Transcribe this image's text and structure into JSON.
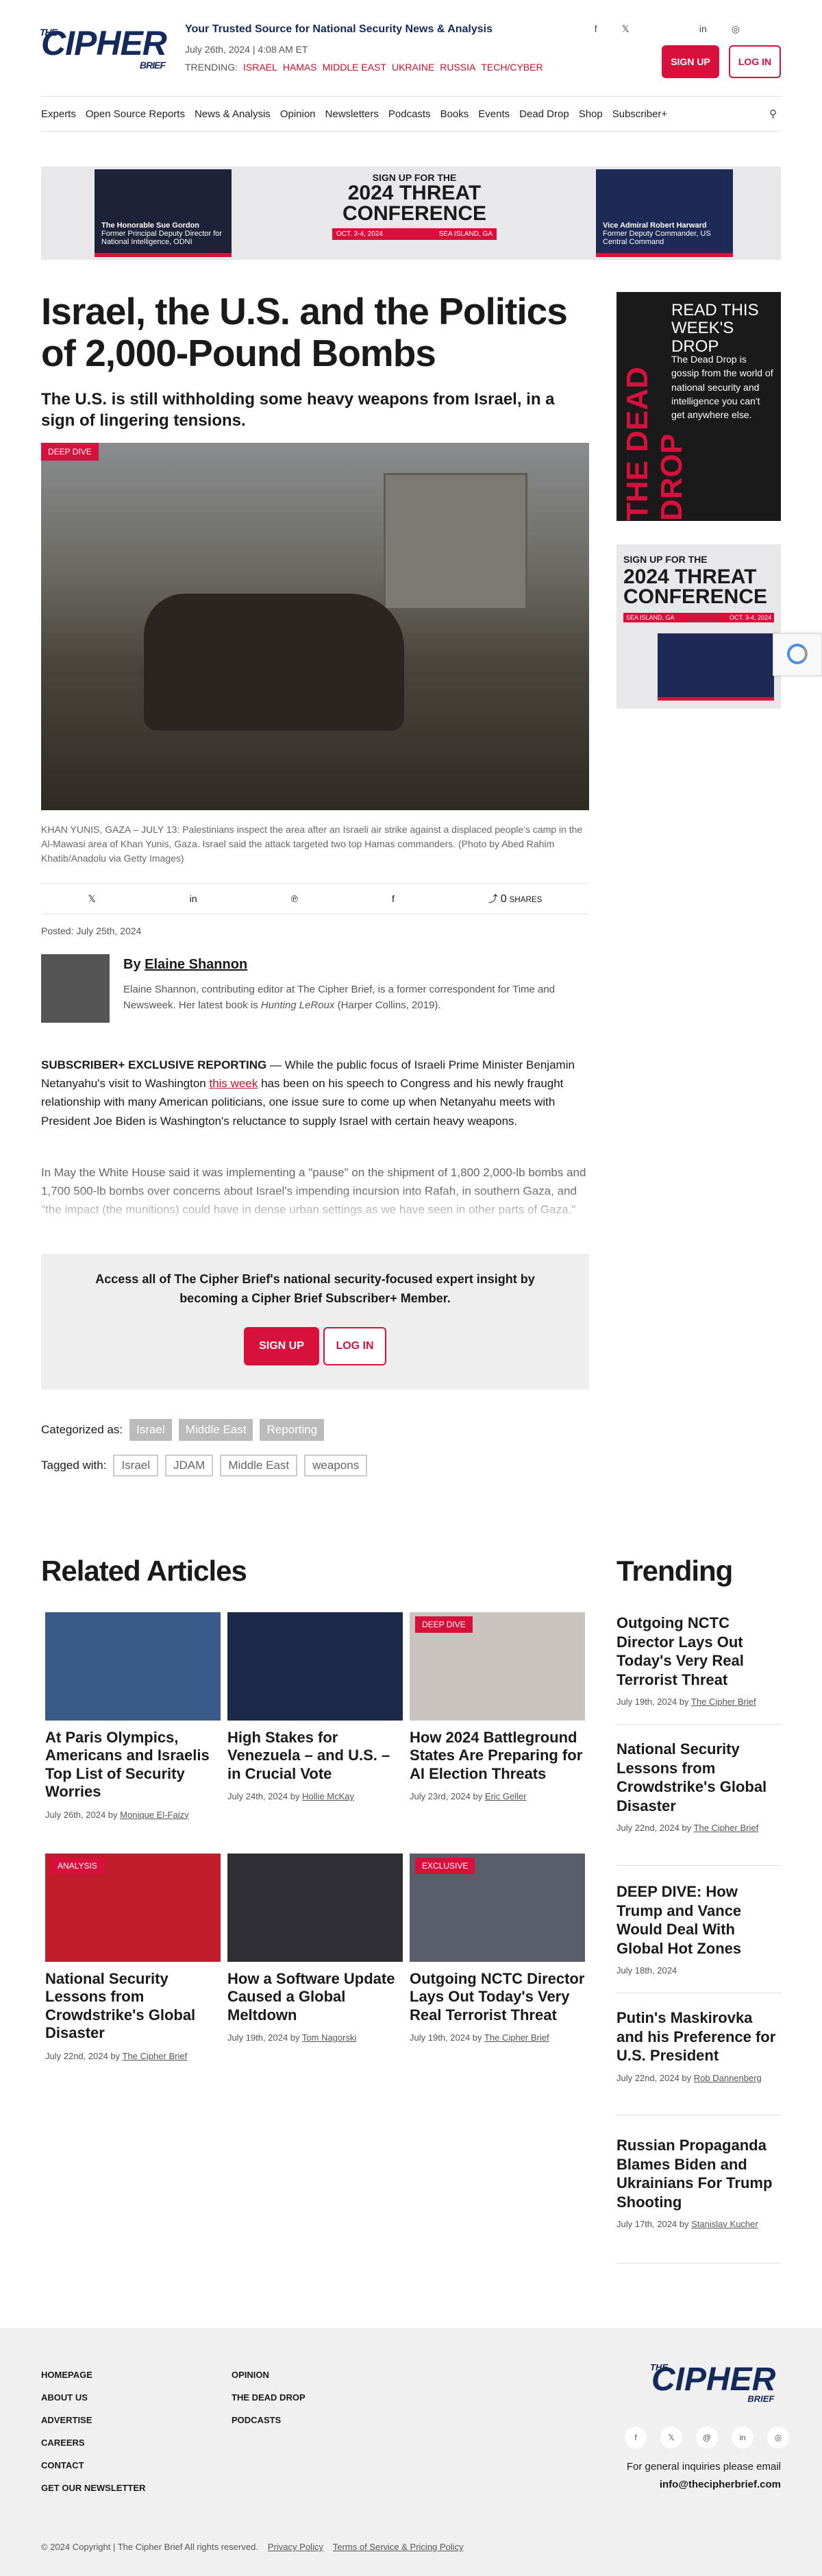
{
  "site": {
    "logo_the": "THE",
    "logo_main": "CIPHER",
    "logo_brief": "BRIEF",
    "tagline": "Your Trusted Source for National Security News & Analysis",
    "date": "July 26th, 2024 | 4:08 AM ET",
    "trending_label": "TRENDING:",
    "trending": [
      "ISRAEL",
      "HAMAS",
      "MIDDLE EAST",
      "UKRAINE",
      "RUSSIA",
      "TECH/CYBER"
    ],
    "social_icons": [
      "facebook-icon",
      "twitter-icon",
      "linkedin-icon",
      "instagram-icon"
    ],
    "signup": "SIGN UP",
    "login": "LOG IN",
    "accent": "#d8113c"
  },
  "nav": [
    "Experts",
    "Open Source Reports",
    "News & Analysis",
    "Opinion",
    "Newsletters",
    "Podcasts",
    "Books",
    "Events",
    "Dead Drop",
    "Shop",
    "Subscriber+"
  ],
  "banner": {
    "headline_a": "SIGN UP FOR THE",
    "headline_b1": "2024",
    "headline_b2": "THREAT",
    "headline_b3": "CONFERENCE",
    "dates": "OCT. 3-4, 2024",
    "place": "SEA ISLAND, GA",
    "left_person": "The Honorable Sue Gordon",
    "left_role": "Former Principal Deputy Director for National Intelligence, ODNI",
    "right_person": "Vice Admiral Robert Harward",
    "right_role": "Former Deputy Commander, US Central Command"
  },
  "article": {
    "title": "Israel, the U.S. and the Politics of 2,000-Pound Bombs",
    "deck": "The U.S. is still withholding some heavy weapons from Israel, in a sign of lingering tensions.",
    "badge": "DEEP DIVE",
    "caption": "KHAN YUNIS, GAZA – JULY 13: Palestinians inspect the area after an Israeli air strike against a displaced people's camp in the Al-Mawasi area of Khan Yunis, Gaza. Israel said the attack targeted two top Hamas commanders. (Photo by Abed Rahim Khatib/Anadolu via Getty Images)",
    "share_count": "0",
    "share_label": "SHARES",
    "posted": "Posted: July 25th, 2024",
    "author_by": "By",
    "author": "Elaine Shannon",
    "bio_a": "Elaine Shannon, contributing editor at The Cipher Brief, is a former correspondent for Time and Newsweek. Her latest book is ",
    "bio_book": "Hunting LeRoux",
    "bio_b": " (Harper Collins, 2019).",
    "p1_lead": "SUBSCRIBER+ EXCLUSIVE REPORTING",
    "p1_a": " — While the public focus of Israeli Prime Minister Benjamin Netanyahu's visit to Washington ",
    "p1_link": "this week",
    "p1_b": " has been on his speech to Congress and his newly fraught relationship with many American politicians, one issue sure to come up when Netanyahu meets with President Joe Biden is Washington's reluctance to supply Israel with certain heavy weapons.",
    "p2": "In May the White House said it was implementing a \"pause\" on the shipment of 1,800 2,000-lb bombs and 1,700 500-lb bombs over concerns about Israel's impending incursion into Rafah, in southern Gaza, and \"the impact (the munitions) could have in dense urban settings as we have seen in other parts of Gaza.\"",
    "paywall": "Access all of The Cipher Brief's national security-focused expert insight by becoming a Cipher Brief Subscriber+ Member.",
    "paywall_signup": "SIGN UP",
    "paywall_login": "LOG IN",
    "categorized_label": "Categorized as:",
    "categories": [
      "Israel",
      "Middle East",
      "Reporting"
    ],
    "tagged_label": "Tagged with:",
    "tags": [
      "Israel",
      "JDAM",
      "Middle East",
      "weapons"
    ]
  },
  "sidebar": {
    "dead_drop_logo": "THE DEAD DROP",
    "dead_drop_head": "READ THIS WEEK'S DROP",
    "dead_drop_text": "The Dead Drop is gossip from the world of national security and intelligence you can't get anywhere else.",
    "conf_a": "SIGN UP FOR THE",
    "conf_b": "2024 THREAT CONFERENCE",
    "conf_place": "SEA ISLAND, GA",
    "conf_dates": "OCT. 3-4, 2024"
  },
  "related": {
    "heading": "Related Articles",
    "items": [
      {
        "badge": "",
        "title": "At Paris Olympics, Americans and Israelis Top List of Security Worries",
        "date": "July 26th, 2024 by",
        "author": "Monique El-Faizy",
        "bg": "#3a5a8a"
      },
      {
        "badge": "",
        "title": "High Stakes for Venezuela – and U.S. – in Crucial Vote",
        "date": "July 24th, 2024 by",
        "author": "Hollie McKay",
        "bg": "#1c2a4a"
      },
      {
        "badge": "DEEP DIVE",
        "title": "How 2024 Battleground States Are Preparing for AI Election Threats",
        "date": "July 23rd, 2024 by",
        "author": "Eric Geller",
        "bg": "#c9c4c0"
      },
      {
        "badge": "ANALYSIS",
        "title": "National Security Lessons from Crowdstrike's Global Disaster",
        "date": "July 22nd, 2024 by",
        "author": "The Cipher Brief",
        "bg": "#c01c2c"
      },
      {
        "badge": "",
        "title": "How a Software Update Caused a Global Meltdown",
        "date": "July 19th, 2024 by",
        "author": "Tom Nagorski",
        "bg": "#2e2e34"
      },
      {
        "badge": "EXCLUSIVE",
        "title": "Outgoing NCTC Director Lays Out Today's Very Real Terrorist Threat",
        "date": "July 19th, 2024 by",
        "author": "The Cipher Brief",
        "bg": "#5a5e6a"
      }
    ]
  },
  "trending_col": {
    "heading": "Trending",
    "items": [
      {
        "title": "Outgoing NCTC Director Lays Out Today's Very Real Terrorist Threat",
        "date": "July 19th, 2024 by",
        "author": "The Cipher Brief"
      },
      {
        "title": "National Security Lessons from Crowdstrike's Global Disaster",
        "date": "July 22nd, 2024 by",
        "author": "The Cipher Brief"
      },
      {
        "title": "DEEP DIVE: How Trump and Vance Would Deal With Global Hot Zones",
        "date": "July 18th, 2024",
        "author": ""
      },
      {
        "title": "Putin's Maskirovka and his Preference for U.S. President",
        "date": "July 22nd, 2024 by",
        "author": "Rob Dannenberg"
      },
      {
        "title": "Russian Propaganda Blames Biden and Ukrainians For Trump Shooting",
        "date": "July 17th, 2024 by",
        "author": "Stanislav Kucher"
      }
    ]
  },
  "footer": {
    "col1": [
      "HOMEPAGE",
      "ABOUT US",
      "ADVERTISE",
      "CAREERS",
      "CONTACT",
      "GET OUR NEWSLETTER"
    ],
    "col2": [
      "OPINION",
      "THE DEAD DROP",
      "PODCASTS"
    ],
    "inquiries": "For general inquiries please email",
    "email": "info@thecipherbrief.com",
    "copyright": "© 2024 Copyright | The Cipher Brief All rights reserved.",
    "privacy": "Privacy Policy",
    "terms": "Terms of Service & Pricing Policy"
  }
}
